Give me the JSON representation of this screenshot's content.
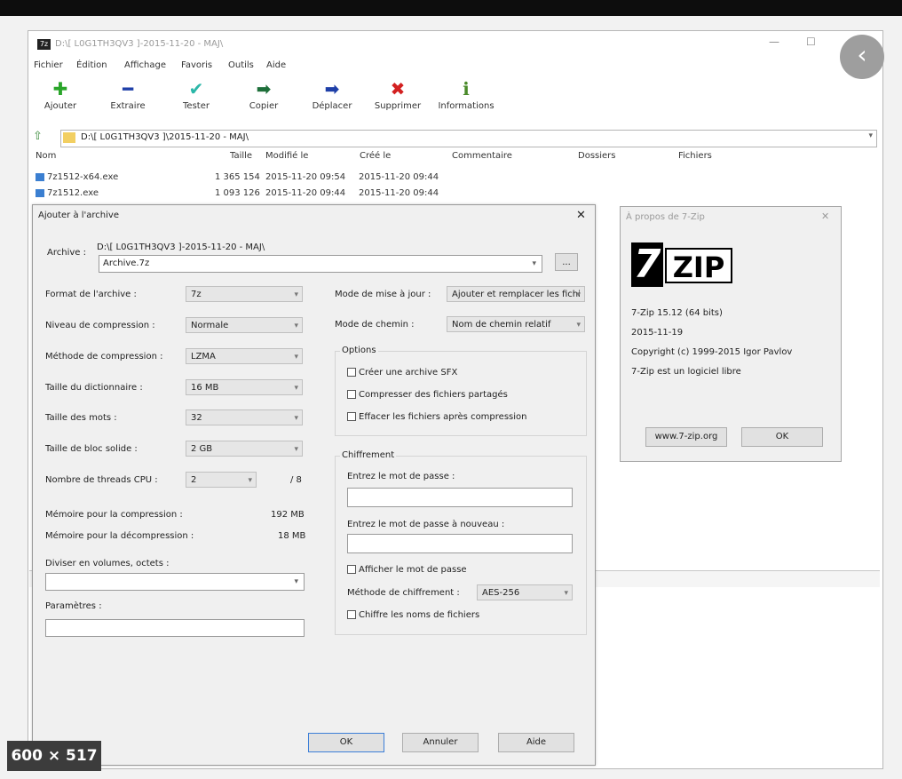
{
  "window": {
    "title": "D:\\[ L0G1TH3QV3 ]-2015-11-20 - MAJ\\",
    "minimize_glyph": "—",
    "maximize_glyph": "☐"
  },
  "menu": [
    "Fichier",
    "Édition",
    "Affichage",
    "Favoris",
    "Outils",
    "Aide"
  ],
  "toolbar": [
    {
      "label": "Ajouter",
      "icon": "plus-icon",
      "glyph": "✚",
      "color": "#2aa52a"
    },
    {
      "label": "Extraire",
      "icon": "minus-icon",
      "glyph": "━",
      "color": "#1e3fa8"
    },
    {
      "label": "Tester",
      "icon": "check-icon",
      "glyph": "✔",
      "color": "#2bb7a8"
    },
    {
      "label": "Copier",
      "icon": "copy-arrow-icon",
      "glyph": "➡",
      "color": "#1e6f3a"
    },
    {
      "label": "Déplacer",
      "icon": "move-arrow-icon",
      "glyph": "➡",
      "color": "#1e3fa8"
    },
    {
      "label": "Supprimer",
      "icon": "delete-x-icon",
      "glyph": "✖",
      "color": "#d32020"
    },
    {
      "label": "Informations",
      "icon": "info-icon",
      "glyph": "ℹ",
      "color": "#4a8a2a"
    }
  ],
  "path": "D:\\[ L0G1TH3QV3 ]\\2015-11-20 - MAJ\\",
  "columns": [
    "Nom",
    "Taille",
    "Modifié le",
    "Créé le",
    "Commentaire",
    "Dossiers",
    "Fichiers"
  ],
  "files": [
    {
      "name": "7z1512-x64.exe",
      "size": "1 365 154",
      "modified": "2015-11-20 09:54",
      "created": "2015-11-20 09:44"
    },
    {
      "name": "7z1512.exe",
      "size": "1 093 126",
      "modified": "2015-11-20 09:44",
      "created": "2015-11-20 09:44"
    }
  ],
  "dialog": {
    "title": "Ajouter à l'archive",
    "close": "✕",
    "archive_label": "Archive :",
    "archive_path": "D:\\[ L0G1TH3QV3 ]-2015-11-20 - MAJ\\",
    "archive_name": "Archive.7z",
    "browse": "...",
    "format_label": "Format de l'archive :",
    "format_value": "7z",
    "level_label": "Niveau de compression :",
    "level_value": "Normale",
    "method_label": "Méthode de compression :",
    "method_value": "LZMA",
    "dict_label": "Taille du dictionnaire :",
    "dict_value": "16 MB",
    "word_label": "Taille des mots :",
    "word_value": "32",
    "solid_label": "Taille de bloc solide :",
    "solid_value": "2 GB",
    "threads_label": "Nombre de threads CPU :",
    "threads_value": "2",
    "threads_max": "/ 8",
    "mem_comp_label": "Mémoire pour la compression :",
    "mem_comp_value": "192 MB",
    "mem_decomp_label": "Mémoire pour la décompression :",
    "mem_decomp_value": "18 MB",
    "split_label": "Diviser en volumes, octets :",
    "params_label": "Paramètres :",
    "update_label": "Mode de mise à jour :",
    "update_value": "Ajouter et remplacer les fichi",
    "pathmode_label": "Mode de chemin :",
    "pathmode_value": "Nom de chemin relatif",
    "options_title": "Options",
    "opt_sfx": "Créer une archive SFX",
    "opt_shared": "Compresser des fichiers partagés",
    "opt_delete": "Effacer les fichiers après compression",
    "enc_title": "Chiffrement",
    "enc_pwd_label": "Entrez le mot de passe :",
    "enc_pwd2_label": "Entrez le mot de passe à nouveau :",
    "enc_show": "Afficher le mot de passe",
    "enc_method_label": "Méthode de chiffrement :",
    "enc_method_value": "AES-256",
    "enc_names": "Chiffre les noms de fichiers",
    "ok": "OK",
    "cancel": "Annuler",
    "help": "Aide"
  },
  "about": {
    "title": "À propos de 7-Zip",
    "close": "✕",
    "logo_left": "7",
    "logo_right": "ZIP",
    "version": "7-Zip 15.12 (64 bits)",
    "date": "2015-11-19",
    "copyright": "Copyright (c) 1999-2015 Igor Pavlov",
    "license": "7-Zip est un logiciel libre",
    "website": "www.7-zip.org",
    "ok": "OK"
  },
  "image_badge": "600 × 517",
  "back_button_glyph": "‹"
}
